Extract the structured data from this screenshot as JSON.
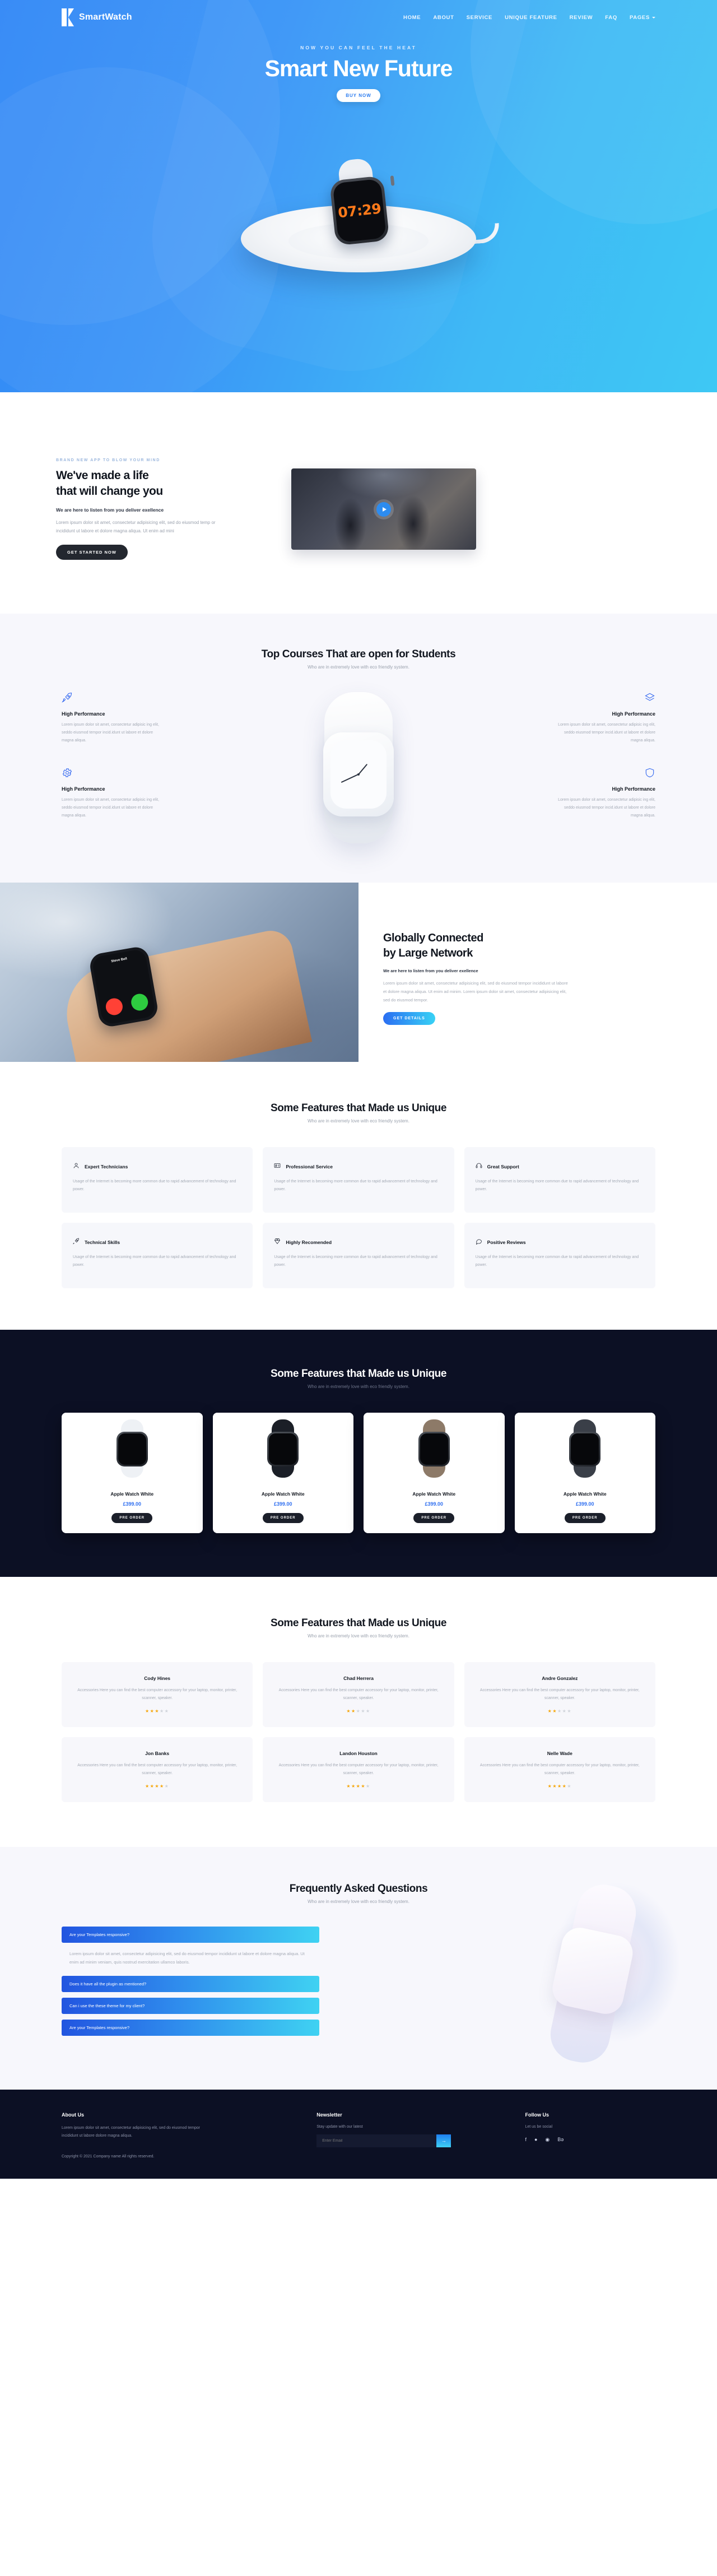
{
  "nav": {
    "brand": "SmartWatch",
    "brand_icon": "smartwatch-logo-icon",
    "links": [
      "HOME",
      "ABOUT",
      "SERVICE",
      "UNIQUE FEATURE",
      "REVIEW",
      "FAQ",
      "PAGES"
    ]
  },
  "hero": {
    "kicker": "NOW YOU CAN FEEL THE HEAT",
    "title": "Smart New Future",
    "cta": "BUY NOW",
    "watch_time": "07:29"
  },
  "about": {
    "kicker": "BRAND NEW APP TO BLOW YOUR MIND",
    "title_line1": "We've made a life",
    "title_line2": "that will change you",
    "lead": "We are here to listen from you deliver exellence",
    "body": "Lorem ipsum dolor sit amet, consectetur adipisicing elit, sed do eiusmod temp or incididunt ut labore et dolore magna aliqua. Ut enim ad mini",
    "cta": "GET STARTED NOW",
    "play_icon": "play-icon"
  },
  "courses": {
    "title": "Top Courses That are open for Students",
    "subtitle": "Who are in extremely love with eco friendly system.",
    "left": [
      {
        "icon": "rocket-icon",
        "title": "High Performance",
        "text": "Lorem ipsum dolor sit amet, consectetur adipisic ing elit, seddo eiusmod tempor incid.idunt ut labore et dolore magna aliqua."
      },
      {
        "icon": "gear-icon",
        "title": "High Performance",
        "text": "Lorem ipsum dolor sit amet, consectetur adipisic ing elit, seddo eiusmod tempor incid.idunt ut labore et dolore magna aliqua."
      }
    ],
    "right": [
      {
        "icon": "layers-icon",
        "title": "High Performance",
        "text": "Lorem ipsum dolor sit amet, consectetur adipisic ing elit, seddo eiusmod tempor incid.idunt ut labore et dolore magna aliqua."
      },
      {
        "icon": "shield-icon",
        "title": "High Performance",
        "text": "Lorem ipsum dolor sit amet, consectetur adipisic ing elit, seddo eiusmod tempor incid.idunt ut labore et dolore magna aliqua."
      }
    ]
  },
  "global": {
    "title_line1": "Globally Connected",
    "title_line2": "by Large Network",
    "lead": "We are here to listen from you deliver exellence",
    "body": "Lorem ipsum dolor sit amet, consectetur adipisicing elit, sed do eiusmod tempor incididunt ut labore et dolore magna aliqua. Ut enim ad minim. Lorem ipsum dolor sit amet, consectetur adipisicing elit, sed do eiusmod tempor.",
    "cta": "GET DETAILS",
    "call_name": "Steve Bell",
    "decline_icon": "phone-decline-icon",
    "accept_icon": "phone-accept-icon"
  },
  "features": {
    "title": "Some Features that Made us Unique",
    "subtitle": "Who are in extremely love with eco friendly system.",
    "cards": [
      {
        "icon": "user-icon",
        "title": "Expert Technicians",
        "text": "Usage of the Internet is becoming more common due to rapid advancement of technology and power."
      },
      {
        "icon": "id-card-icon",
        "title": "Professional Service",
        "text": "Usage of the Internet is becoming more common due to rapid advancement of technology and power."
      },
      {
        "icon": "headset-icon",
        "title": "Great Support",
        "text": "Usage of the Internet is becoming more common due to rapid advancement of technology and power."
      },
      {
        "icon": "rocket-icon",
        "title": "Technical Skills",
        "text": "Usage of the Internet is becoming more common due to rapid advancement of technology and power."
      },
      {
        "icon": "diamond-icon",
        "title": "Highly Recomended",
        "text": "Usage of the Internet is becoming more common due to rapid advancement of technology and power."
      },
      {
        "icon": "chat-icon",
        "title": "Positive Reviews",
        "text": "Usage of the Internet is becoming more common due to rapid advancement of technology and power."
      }
    ]
  },
  "products": {
    "title": "Some Features that Made us Unique",
    "subtitle": "Who are in extremely love with eco friendly system.",
    "items": [
      {
        "name": "Apple Watch White",
        "price": "£399.00",
        "cta": "PRE ORDER",
        "band_color": "#eef1f5"
      },
      {
        "name": "Apple Watch White",
        "price": "£399.00",
        "cta": "PRE ORDER",
        "band_color": "#1b1f27"
      },
      {
        "name": "Apple Watch White",
        "price": "£399.00",
        "cta": "PRE ORDER",
        "band_color": "#8d7a68"
      },
      {
        "name": "Apple Watch White",
        "price": "£399.00",
        "cta": "PRE ORDER",
        "band_color": "#3a3f48"
      }
    ]
  },
  "testimonials": {
    "title": "Some Features that Made us Unique",
    "subtitle": "Who are in extremely love with eco friendly system.",
    "items": [
      {
        "name": "Cody Hines",
        "text": "Accessories Here you can find the best computer accessory for your laptop, monitor, printer, scanner, speaker.",
        "rating": 3
      },
      {
        "name": "Chad Herrera",
        "text": "Accessories Here you can find the best computer accessory for your laptop, monitor, printer, scanner, speaker.",
        "rating": 2
      },
      {
        "name": "Andre Gonzalez",
        "text": "Accessories Here you can find the best computer accessory for your laptop, monitor, printer, scanner, speaker.",
        "rating": 2
      },
      {
        "name": "Jon Banks",
        "text": "Accessories Here you can find the best computer accessory for your laptop, monitor, printer, scanner, speaker.",
        "rating": 4
      },
      {
        "name": "Landon Houston",
        "text": "Accessories Here you can find the best computer accessory for your laptop, monitor, printer, scanner, speaker.",
        "rating": 4
      },
      {
        "name": "Nelle Wade",
        "text": "Accessories Here you can find the best computer accessory for your laptop, monitor, printer, scanner, speaker.",
        "rating": 4
      }
    ]
  },
  "faq": {
    "title": "Frequently Asked Questions",
    "subtitle": "Who are in extremely love with eco friendly system.",
    "items": [
      {
        "q": "Are your Templates responsive?",
        "a": "Lorem ipsum dolor sit amet, consectetur adipisicing elit, sed do eiusmod tempor incididunt ut labore et dolore magna aliqua. Ut enim ad minim veniam, quis nostrud exercitation ullamco laboris.",
        "open": true
      },
      {
        "q": "Does it have all the plugin as mentioned?",
        "a": "",
        "open": false
      },
      {
        "q": "Can i use the these theme for my client?",
        "a": "",
        "open": false
      },
      {
        "q": "Are your Templates responsive?",
        "a": "",
        "open": false
      }
    ]
  },
  "footer": {
    "about_title": "About Us",
    "about_text": "Lorem ipsum dolor sit amet, consectetur adipisicing elit, sed do eiusmod tempor incididunt ut labore dolore magna aliqua.",
    "copyright": "Copyright © 2021 Company name All rights reserved.",
    "newsletter_title": "Newsletter",
    "newsletter_sub": "Stay update with our latest",
    "newsletter_placeholder": "Enter Email",
    "newsletter_button_icon": "arrow-right-icon",
    "follow_title": "Follow Us",
    "follow_sub": "Let us be social",
    "social": [
      "facebook-icon",
      "twitter-icon",
      "dribbble-icon",
      "behance-icon"
    ]
  },
  "colors": {
    "brand_blue": "#2f86f6",
    "accent_cyan": "#3fd2f2",
    "dark": "#0c1024",
    "price": "#2f6ff0",
    "star_on": "#f6a609"
  }
}
